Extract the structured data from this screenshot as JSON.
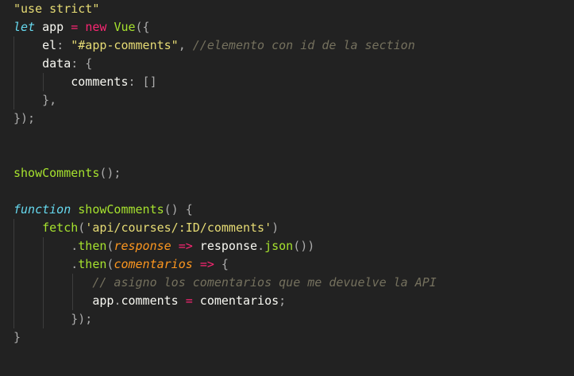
{
  "colors": {
    "background": "#222222",
    "string": "#e6db74",
    "keyword": "#f92672",
    "storage": "#66d9ef",
    "function": "#a6e22e",
    "comment": "#75715e",
    "parameter": "#fd971f",
    "plain": "#f8f8f2",
    "punctuation": "#ababab",
    "indent_guide": "#3d3d3d"
  },
  "lines": [
    [
      {
        "t": "\"use strict\"",
        "k": "str"
      }
    ],
    [
      {
        "t": "let",
        "k": "storage"
      },
      {
        "t": " app ",
        "k": "ident"
      },
      {
        "t": "=",
        "k": "op"
      },
      {
        "t": " ",
        "k": "ident"
      },
      {
        "t": "new",
        "k": "kw"
      },
      {
        "t": " ",
        "k": "ident"
      },
      {
        "t": "Vue",
        "k": "class"
      },
      {
        "t": "({",
        "k": "punct"
      }
    ],
    [
      {
        "t": "    el",
        "k": "prop"
      },
      {
        "t": ": ",
        "k": "punct"
      },
      {
        "t": "\"#app-comments\"",
        "k": "str"
      },
      {
        "t": ", ",
        "k": "punct"
      },
      {
        "t": "//elemento con id de la section",
        "k": "comment"
      }
    ],
    [
      {
        "t": "    data",
        "k": "prop"
      },
      {
        "t": ": {",
        "k": "punct"
      }
    ],
    [
      {
        "t": "        comments",
        "k": "prop"
      },
      {
        "t": ": []",
        "k": "punct"
      }
    ],
    [
      {
        "t": "    },",
        "k": "punct"
      }
    ],
    [
      {
        "t": "});",
        "k": "punct"
      }
    ],
    [],
    [],
    [
      {
        "t": "showComments",
        "k": "func"
      },
      {
        "t": "();",
        "k": "punct"
      }
    ],
    [],
    [
      {
        "t": "function",
        "k": "storage"
      },
      {
        "t": " ",
        "k": "ident"
      },
      {
        "t": "showComments",
        "k": "func"
      },
      {
        "t": "() {",
        "k": "punct"
      }
    ],
    [
      {
        "t": "    ",
        "k": "ident"
      },
      {
        "t": "fetch",
        "k": "func"
      },
      {
        "t": "(",
        "k": "punct"
      },
      {
        "t": "'api/courses/:ID/comments'",
        "k": "str"
      },
      {
        "t": ")",
        "k": "punct"
      }
    ],
    [
      {
        "t": "        ",
        "k": "ident"
      },
      {
        "t": ".",
        "k": "punct"
      },
      {
        "t": "then",
        "k": "func"
      },
      {
        "t": "(",
        "k": "punct"
      },
      {
        "t": "response",
        "k": "param"
      },
      {
        "t": " ",
        "k": "ident"
      },
      {
        "t": "=>",
        "k": "arrow"
      },
      {
        "t": " response",
        "k": "ident"
      },
      {
        "t": ".",
        "k": "punct"
      },
      {
        "t": "json",
        "k": "func"
      },
      {
        "t": "())",
        "k": "punct"
      }
    ],
    [
      {
        "t": "        ",
        "k": "ident"
      },
      {
        "t": ".",
        "k": "punct"
      },
      {
        "t": "then",
        "k": "func"
      },
      {
        "t": "(",
        "k": "punct"
      },
      {
        "t": "comentarios",
        "k": "param"
      },
      {
        "t": " ",
        "k": "ident"
      },
      {
        "t": "=>",
        "k": "arrow"
      },
      {
        "t": " {",
        "k": "punct"
      }
    ],
    [
      {
        "t": "           ",
        "k": "ident"
      },
      {
        "t": "// asigno los comentarios que me devuelve la API",
        "k": "comment"
      }
    ],
    [
      {
        "t": "           app",
        "k": "ident"
      },
      {
        "t": ".",
        "k": "punct"
      },
      {
        "t": "comments ",
        "k": "prop"
      },
      {
        "t": "=",
        "k": "op"
      },
      {
        "t": " comentarios",
        "k": "ident"
      },
      {
        "t": ";",
        "k": "punct"
      }
    ],
    [
      {
        "t": "        });",
        "k": "punct"
      }
    ],
    [
      {
        "t": "}",
        "k": "punct"
      }
    ]
  ]
}
